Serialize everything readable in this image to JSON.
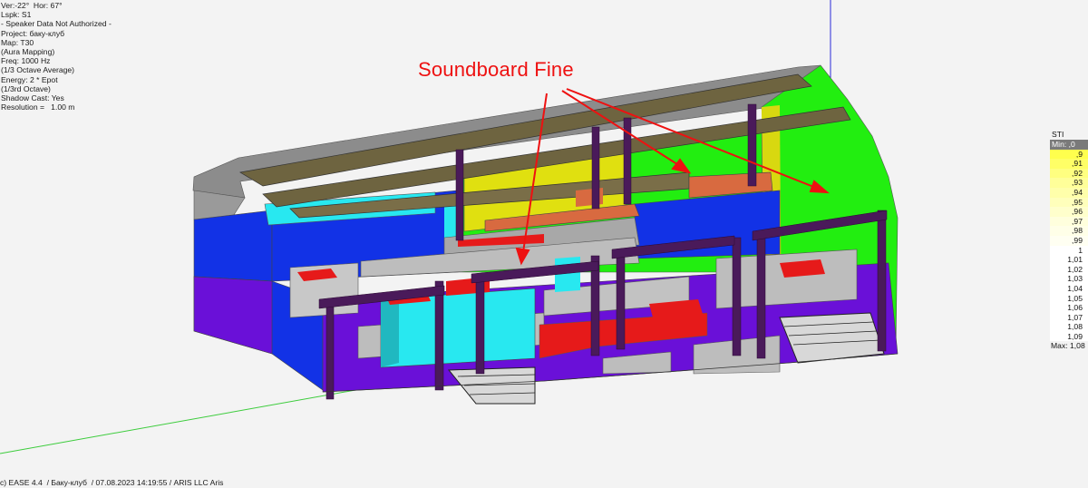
{
  "info_lines": [
    "Ver:-22°  Hor: 67°",
    "Lspk: S1",
    "- Speaker Data Not Authorized -",
    "Project: бакy-клyб",
    "Map: T30",
    "(Aura Mapping)",
    "Freq: 1000 Hz",
    "(1/3 Octave Average)",
    "Energy: 2 * Epot",
    "(1/3rd Octave)",
    "Shadow Cast: Yes",
    "Resolution =   1.00 m"
  ],
  "annotation": {
    "label": "Soundboard Fine",
    "color": "#ee1111"
  },
  "legend": {
    "title": "STI",
    "min_label": "Min: ,0",
    "items": [
      {
        "label": ",9",
        "color": "#ffff4d"
      },
      {
        "label": ",91",
        "color": "#ffff66"
      },
      {
        "label": ",92",
        "color": "#ffff80"
      },
      {
        "label": ",93",
        "color": "#ffff99"
      },
      {
        "label": ",94",
        "color": "#ffffaa"
      },
      {
        "label": ",95",
        "color": "#ffffbb"
      },
      {
        "label": ",96",
        "color": "#ffffcc"
      },
      {
        "label": ",97",
        "color": "#ffffdd"
      },
      {
        "label": ",98",
        "color": "#ffffe8"
      },
      {
        "label": ",99",
        "color": "#fffff2"
      },
      {
        "label": "1",
        "color": "#ffffff"
      },
      {
        "label": "1,01",
        "color": "#ffffff"
      },
      {
        "label": "1,02",
        "color": "#ffffff"
      },
      {
        "label": "1,03",
        "color": "#ffffff"
      },
      {
        "label": "1,04",
        "color": "#ffffff"
      },
      {
        "label": "1,05",
        "color": "#ffffff"
      },
      {
        "label": "1,06",
        "color": "#ffffff"
      },
      {
        "label": "1,07",
        "color": "#ffffff"
      },
      {
        "label": "1,08",
        "color": "#ffffff"
      },
      {
        "label": "1,09",
        "color": "#ffffff"
      }
    ],
    "max_label": "Max:  1,08"
  },
  "footer": "c) EASE 4.4  / Баку-клуб  / 07.08.2023 14:19:55 / ARIS LLC Aris",
  "colors": {
    "background": "#f3f3f3",
    "roof": "#8c8c8c",
    "blue_wall": "#1232e6",
    "purple_floor": "#6a10d8",
    "green_wall": "#22ee10",
    "yellow_wall": "#e0e010",
    "cyan": "#28e8f0",
    "red": "#e61a1a",
    "dark_post": "#4a1a5a",
    "olive_panel": "#6e6440"
  }
}
